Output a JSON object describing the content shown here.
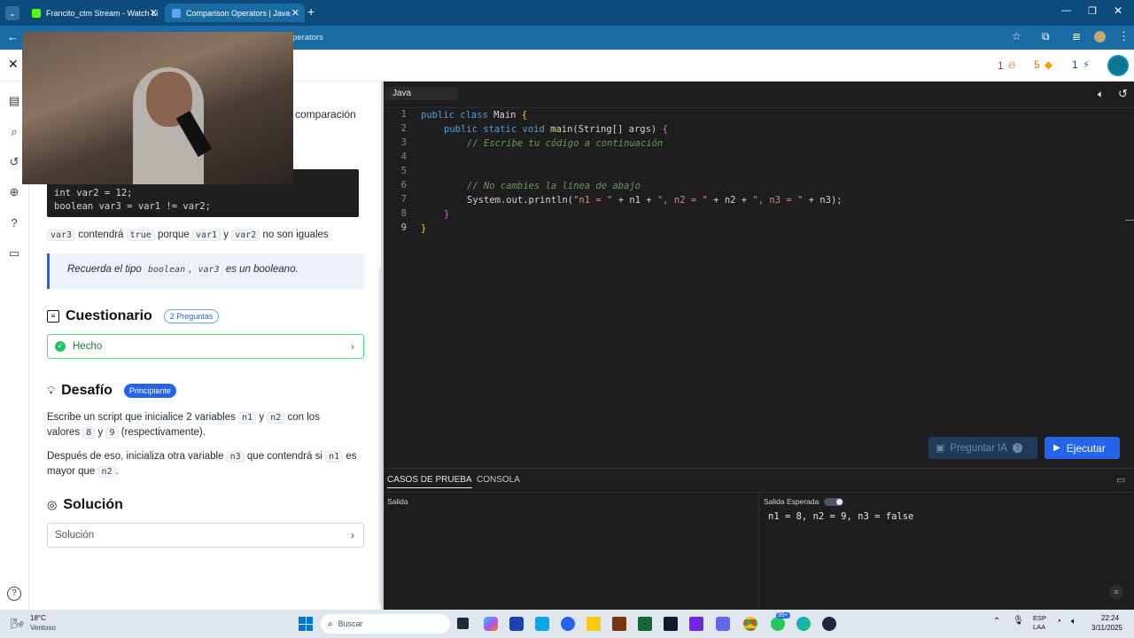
{
  "browser": {
    "tabs": [
      {
        "title": "Francito_ctm Stream - Watch Li",
        "active": false
      },
      {
        "title": "Comparison Operators | Java",
        "active": true
      }
    ],
    "address_partial": "perators"
  },
  "app_header": {
    "streak": "1",
    "gems": "5",
    "energy": "1"
  },
  "lesson": {
    "partial_text": "comparación",
    "code_lines": [
      "int var2 = 12;",
      "boolean var3 = var1 != var2;"
    ],
    "explanation": {
      "code1": "var3",
      "text1": "contendrá",
      "code2": "true",
      "text2": "porque",
      "code3": "var1",
      "text3": "y",
      "code4": "var2",
      "text4": "no son iguales"
    },
    "tip": {
      "prefix": "Recuerda el tipo",
      "code1": "boolean",
      "sep": ",",
      "code2": "var3",
      "suffix": "es un booleano."
    },
    "quiz": {
      "title": "Cuestionario",
      "badge": "2 Preguntas",
      "status": "Hecho"
    },
    "challenge": {
      "title": "Desafío",
      "badge": "Principiante",
      "p1": {
        "t1": "Escribe un script que inicialice 2 variables",
        "c1": "n1",
        "t2": "y",
        "c2": "n2",
        "t3": "con los valores",
        "c3": "8",
        "t4": "y",
        "c4": "9",
        "t5": "(respectivamente)."
      },
      "p2": {
        "t1": "Después de eso, inicializa otra variable",
        "c1": "n3",
        "t2": "que contendrá si",
        "c2": "n1",
        "t3": "es mayor que",
        "c3": "n2",
        "t4": "."
      }
    },
    "solution": {
      "title": "Solución",
      "button": "Solución"
    }
  },
  "editor": {
    "language": "Java",
    "line_numbers": [
      "1",
      "2",
      "3",
      "4",
      "5",
      "6",
      "7",
      "8",
      "9"
    ],
    "lines": {
      "l1": {
        "kw": "public class",
        "rest": " Main ",
        "br": "{"
      },
      "l2": {
        "kw": "public static void",
        "fn": " main",
        "rest": "(String[] args) ",
        "br": "{"
      },
      "l3": "// Escribe tu código a continuación",
      "l6": "// No cambies la línea de abajo",
      "l7": {
        "a": "System.out.println(",
        "s1": "\"n1 = \"",
        "b": " + n1 + ",
        "s2": "\", n2 = \"",
        "c": " + n2 + ",
        "s3": "\", n3 = \"",
        "d": " + n3);"
      },
      "l8": "}",
      "l9": "}"
    },
    "ask_ai": "Preguntar IA",
    "run": "Ejecutar"
  },
  "results": {
    "tabs": [
      "CASOS DE PRUEBA",
      "CONSOLA"
    ],
    "output_label": "Salida",
    "expected_label": "Salida Esperada",
    "expected_value": "n1 = 8, n2 = 9, n3 = false"
  },
  "taskbar": {
    "weather_temp": "18°C",
    "weather_desc": "Ventoso",
    "search": "Buscar",
    "badge": "99+",
    "lang1": "ESP",
    "lang2": "LAA",
    "time": "22:24",
    "date": "3/11/2025"
  }
}
